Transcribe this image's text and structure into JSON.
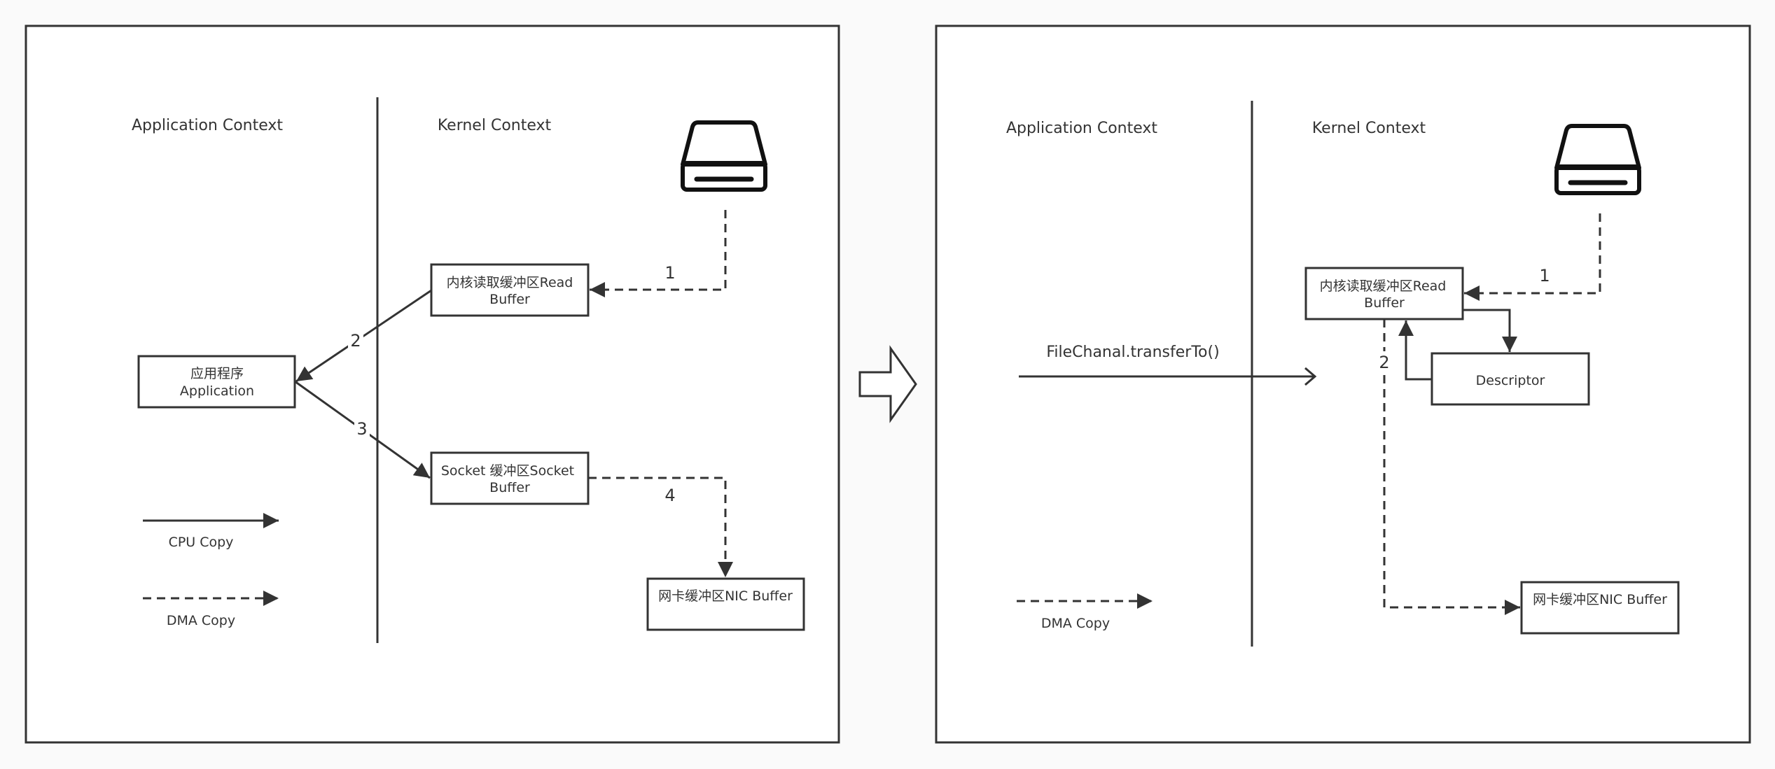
{
  "left_panel": {
    "app_context_label": "Application Context",
    "kernel_context_label": "Kernel Context",
    "icon": "disk-drive-icon",
    "read_buffer": {
      "line1": "内核读取缓冲区Read",
      "line2": "Buffer"
    },
    "application": {
      "line1": "应用程序",
      "line2": "Application"
    },
    "socket_buffer": {
      "line1": "Socket 缓冲区Socket",
      "line2": "Buffer"
    },
    "nic_buffer": {
      "line1": "网卡缓冲区NIC Buffer"
    },
    "step_labels": {
      "s1": "1",
      "s2": "2",
      "s3": "3",
      "s4": "4"
    },
    "legend": {
      "cpu_copy": "CPU Copy",
      "dma_copy": "DMA Copy"
    }
  },
  "transition_icon": "right-arrow-icon",
  "right_panel": {
    "app_context_label": "Application Context",
    "kernel_context_label": "Kernel Context",
    "icon": "disk-drive-icon",
    "call_label": "FileChanal.transferTo()",
    "read_buffer": {
      "line1": "内核读取缓冲区Read",
      "line2": "Buffer"
    },
    "descriptor": {
      "line1": "Descriptor"
    },
    "nic_buffer": {
      "line1": "网卡缓冲区NIC Buffer"
    },
    "step_labels": {
      "s1": "1",
      "s2": "2"
    },
    "legend": {
      "dma_copy": "DMA Copy"
    }
  }
}
